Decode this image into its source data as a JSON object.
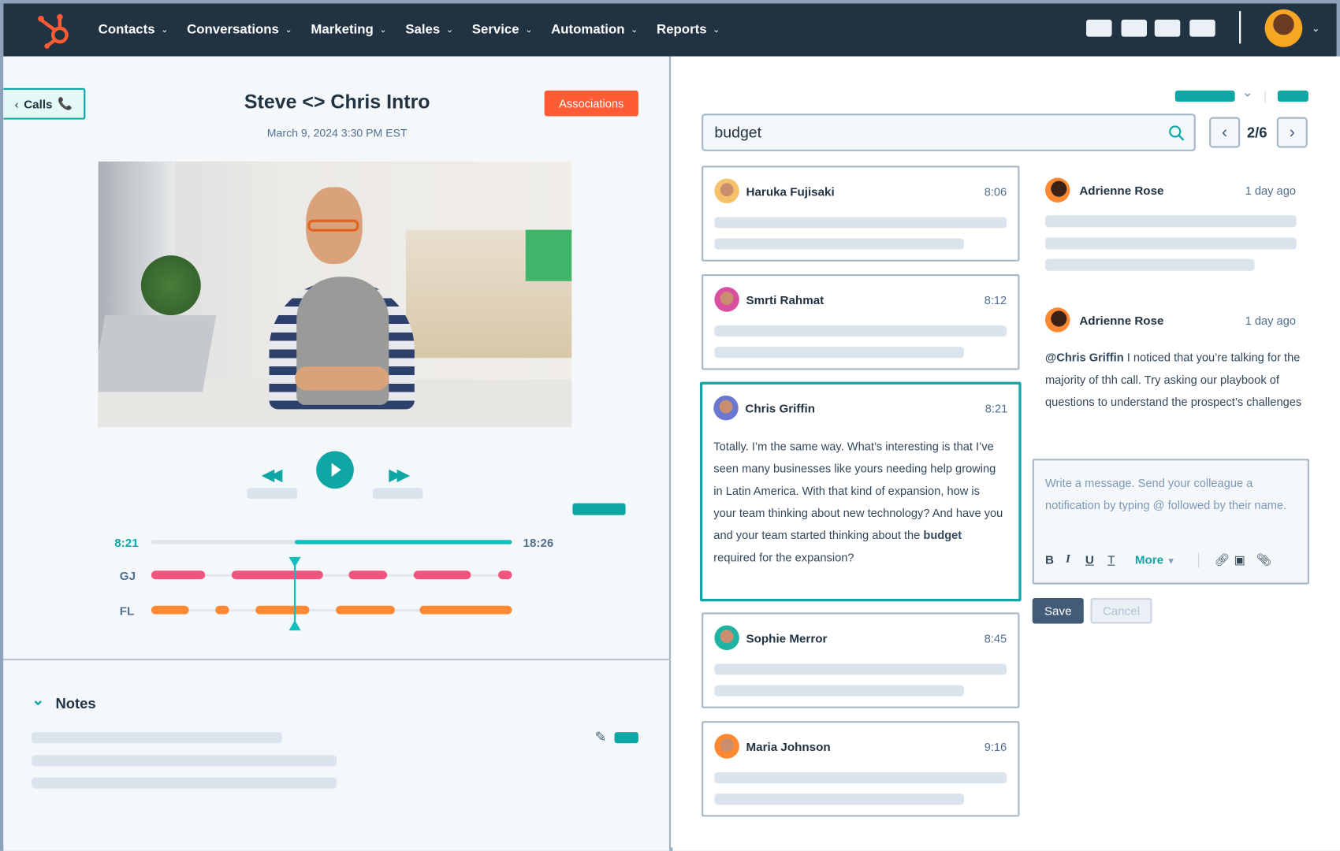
{
  "nav": {
    "items": [
      {
        "label": "Contacts"
      },
      {
        "label": "Conversations"
      },
      {
        "label": "Marketing"
      },
      {
        "label": "Sales"
      },
      {
        "label": "Service"
      },
      {
        "label": "Automation"
      },
      {
        "label": "Reports"
      }
    ],
    "chevron": "⌄",
    "logo": "hubspot-logo"
  },
  "call": {
    "back_label": "Calls",
    "title": "Steve <> Chris Intro",
    "date": "March 9, 2024 3:30 PM EST",
    "associations_label": "Associations"
  },
  "timeline": {
    "current": "8:21",
    "total": "18:26",
    "playhead_fraction": 0.397,
    "speakers": [
      {
        "label": "GJ",
        "color": "#f2547d",
        "segments": [
          [
            0,
            0.15
          ],
          [
            0.223,
            0.476
          ],
          [
            0.547,
            0.654
          ],
          [
            0.727,
            0.886
          ],
          [
            0.962,
            1
          ]
        ]
      },
      {
        "label": "FL",
        "color": "#ff8933",
        "segments": [
          [
            0,
            0.104
          ],
          [
            0.178,
            0.216
          ],
          [
            0.289,
            0.438
          ],
          [
            0.512,
            0.675
          ],
          [
            0.744,
            1
          ]
        ]
      }
    ]
  },
  "notes": {
    "title": "Notes"
  },
  "search": {
    "value": "budget",
    "page": "2/6"
  },
  "transcript": [
    {
      "name": "Haruka Fujisaki",
      "time": "8:06",
      "avatar": "#f5c26b"
    },
    {
      "name": "Smrti Rahmat",
      "time": "8:12",
      "avatar": "#d94fa0"
    },
    {
      "name": "Chris Griffin",
      "time": "8:21",
      "avatar": "#6a78d1",
      "text_before": "Totally. I’m the same way. What’s interesting is that I’ve seen many businesses like yours needing help growing in Latin America. With that kind of expansion, how is your team thinking about new technology? And have you and your team started thinking about the ",
      "highlight": "budget",
      "text_after": " required for the expansion?"
    },
    {
      "name": "Sophie Merror",
      "time": "8:45",
      "avatar": "#1fb3a3"
    },
    {
      "name": "Maria Johnson",
      "time": "9:16",
      "avatar": "#ff8933"
    }
  ],
  "comments": [
    {
      "name": "Adrienne Rose",
      "time": "1 day ago"
    },
    {
      "name": "Adrienne Rose",
      "time": "1 day ago",
      "mention": "@Chris Griffin",
      "text": " I noticed that you’re talking for the majority of thh call. Try asking our playbook of questions to understand the prospect’s challenges"
    }
  ],
  "editor": {
    "placeholder": "Write a message. Send your colleague a notification by typing @ followed by their name.",
    "bold": "B",
    "italic": "I",
    "underline": "U",
    "clear": "T",
    "more": "More",
    "save": "Save",
    "cancel": "Cancel"
  },
  "colors": {
    "accent": "#0fa6a6",
    "nav": "#213343",
    "orange": "#ff5c35"
  }
}
